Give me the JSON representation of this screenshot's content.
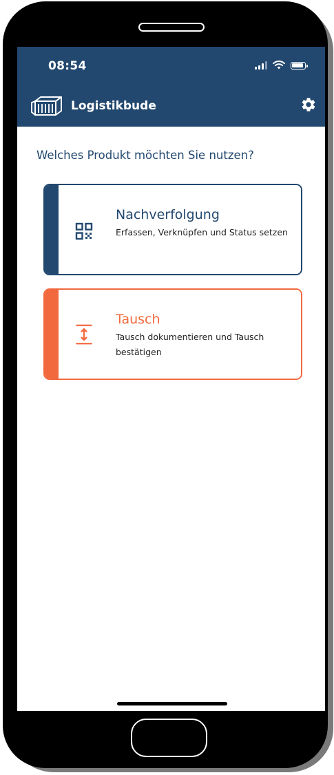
{
  "status_bar": {
    "time": "08:54"
  },
  "header": {
    "app_title": "Logistikbude",
    "logo_icon": "container-icon",
    "settings_icon": "gear-icon"
  },
  "main": {
    "question": "Welches Produkt möchten Sie nutzen?",
    "products": [
      {
        "title": "Nachverfolgung",
        "description": "Erfassen, Verknüpfen und Status setzen",
        "icon": "qr-code-icon",
        "accent_color": "#22486f"
      },
      {
        "title": "Tausch",
        "description": "Tausch dokumentieren und Tausch bestätigen",
        "icon": "swap-vertical-icon",
        "accent_color": "#f2693d"
      }
    ]
  },
  "colors": {
    "primary": "#22486f",
    "accent": "#f2693d",
    "background": "#ffffff"
  }
}
